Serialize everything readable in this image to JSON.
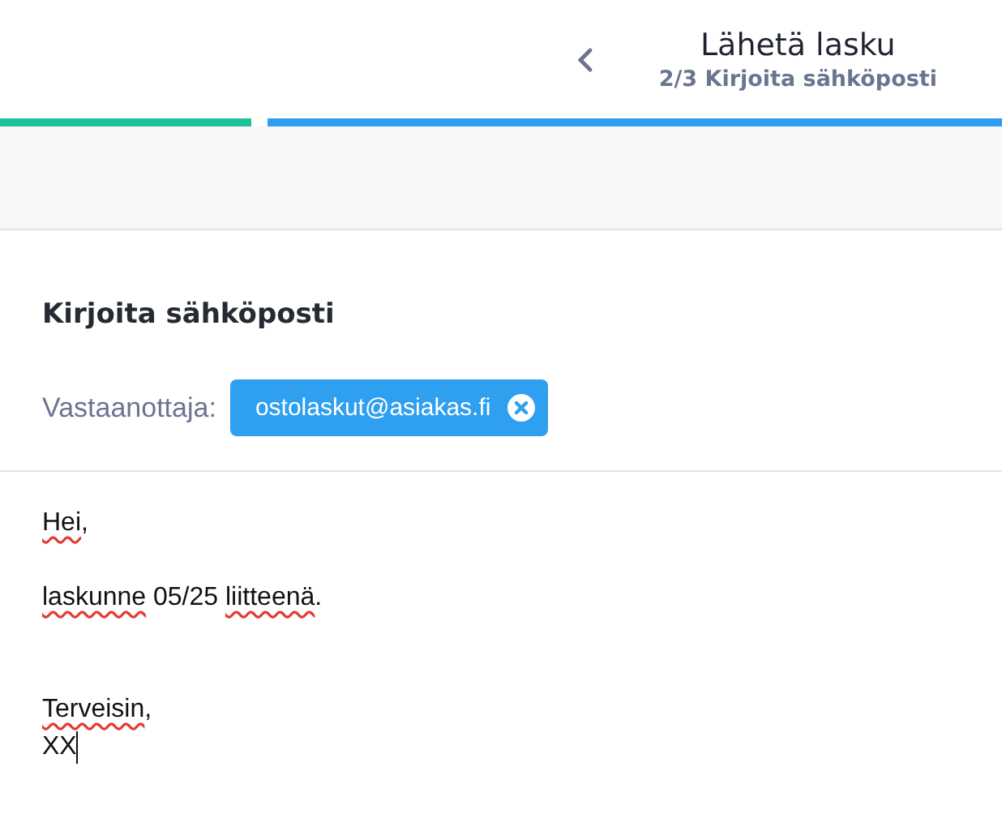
{
  "header": {
    "title": "Lähetä lasku",
    "subtitle": "2/3 Kirjoita sähköposti"
  },
  "progress": [
    {
      "done": true
    },
    {
      "done": false
    }
  ],
  "email": {
    "heading": "Kirjoita sähköposti",
    "recipient_label": "Vastaanottaja:",
    "recipients": [
      {
        "address": "ostolaskut@asiakas.fi"
      }
    ],
    "body": {
      "caret": true,
      "paragraphs": [
        {
          "kind": "normal",
          "lines": [
            [
              {
                "text": "Hei",
                "misspelled": true
              },
              {
                "text": ","
              }
            ]
          ]
        },
        {
          "kind": "normal",
          "lines": [
            [
              {
                "text": "laskunne",
                "misspelled": true
              },
              {
                "text": " 05/25 "
              },
              {
                "text": "liitteenä",
                "misspelled": true
              },
              {
                "text": "."
              }
            ]
          ]
        },
        {
          "kind": "signature",
          "lines": [
            [
              {
                "text": "Terveisin",
                "misspelled": true
              },
              {
                "text": ","
              }
            ],
            [
              {
                "text": "XX"
              }
            ]
          ]
        }
      ]
    }
  }
}
